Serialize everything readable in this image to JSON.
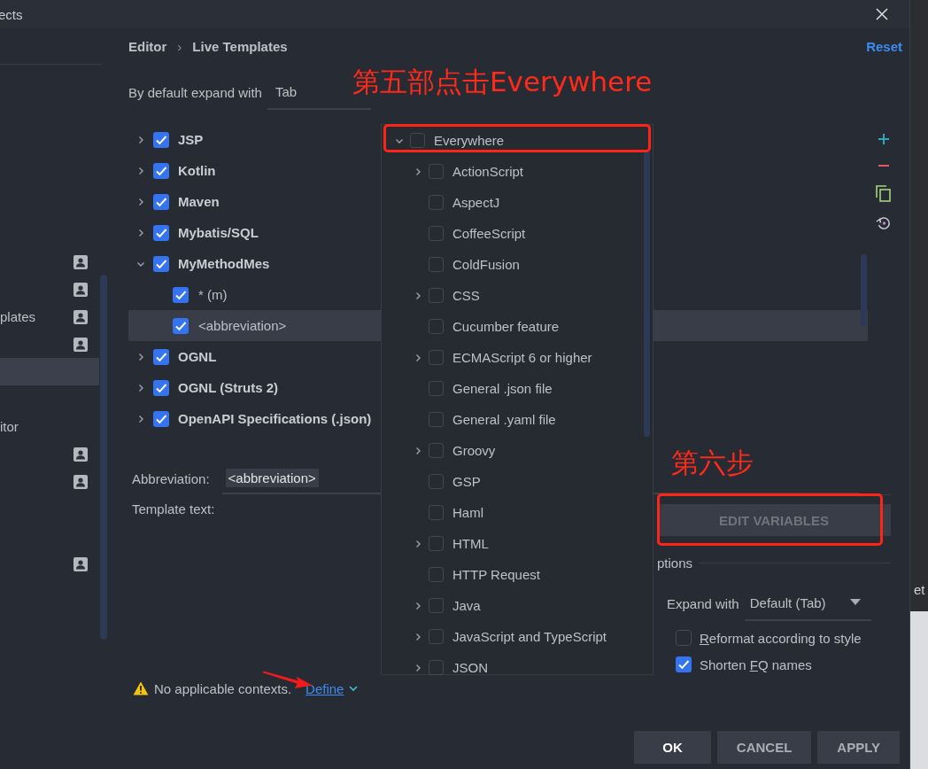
{
  "window": {
    "title": "ects"
  },
  "sidebar": {
    "items": [
      {
        "project_icon": true,
        "selected": false
      },
      {
        "project_icon": true,
        "selected": false
      },
      {
        "label": "plates",
        "project_icon": true,
        "selected": false
      },
      {
        "project_icon": true,
        "selected": false
      },
      {
        "project_icon": false,
        "selected": true
      },
      {
        "project_icon": false,
        "selected": false
      },
      {
        "label": "itor",
        "project_icon": false,
        "selected": false
      },
      {
        "project_icon": true,
        "selected": false
      },
      {
        "project_icon": true,
        "selected": false
      },
      {
        "project_icon": false,
        "selected": false
      },
      {
        "project_icon": false,
        "selected": false
      },
      {
        "project_icon": true,
        "selected": false
      }
    ]
  },
  "breadcrumb": {
    "items": [
      "Editor",
      "Live Templates"
    ],
    "separator": "›"
  },
  "reset_link": "Reset",
  "expand_default": {
    "label": "By default expand with",
    "value": "Tab"
  },
  "template_groups": [
    {
      "label": "JSP",
      "checked": true,
      "expanded": false
    },
    {
      "label": "Kotlin",
      "checked": true,
      "expanded": false
    },
    {
      "label": "Maven",
      "checked": true,
      "expanded": false
    },
    {
      "label": "Mybatis/SQL",
      "checked": true,
      "expanded": false
    },
    {
      "label": "MyMethodMes",
      "checked": true,
      "expanded": true,
      "children": [
        {
          "label": "* (m)",
          "checked": true,
          "selected": false
        },
        {
          "label": "<abbreviation>",
          "checked": true,
          "selected": true
        }
      ]
    },
    {
      "label": "OGNL",
      "checked": true,
      "expanded": false
    },
    {
      "label": "OGNL (Struts 2)",
      "checked": true,
      "expanded": false
    },
    {
      "label": "OpenAPI Specifications (.json)",
      "checked": true,
      "expanded": false
    }
  ],
  "abbreviation": {
    "label": "Abbreviation:",
    "value": "<abbreviation>"
  },
  "template_text": {
    "label": "Template text:"
  },
  "edit_variables_button": {
    "label": "EDIT VARIABLES",
    "disabled": true
  },
  "options": {
    "title": "ptions",
    "expand_with": {
      "label": "Expand with",
      "value": "Default (Tab)"
    },
    "checkboxes": [
      {
        "mnemonic": "R",
        "rest": "eformat according to style",
        "checked": false
      },
      {
        "prefix": "Shorten ",
        "mnemonic": "F",
        "rest": "Q names",
        "checked": true
      }
    ]
  },
  "warning": {
    "text": "No applicable contexts.",
    "link": "Define"
  },
  "buttons": [
    {
      "label": "OK",
      "kind": "default"
    },
    {
      "label": "CANCEL",
      "kind": "normal"
    },
    {
      "label": "APPLY",
      "kind": "normal"
    }
  ],
  "context_popup": {
    "items": [
      {
        "label": "Everywhere",
        "checked": false,
        "expanded": true,
        "children": [
          {
            "label": "ActionScript",
            "checked": false,
            "expandable": true
          },
          {
            "label": "AspectJ",
            "checked": false,
            "expandable": false
          },
          {
            "label": "CoffeeScript",
            "checked": false,
            "expandable": false
          },
          {
            "label": "ColdFusion",
            "checked": false,
            "expandable": false
          },
          {
            "label": "CSS",
            "checked": false,
            "expandable": true
          },
          {
            "label": "Cucumber feature",
            "checked": false,
            "expandable": false
          },
          {
            "label": "ECMAScript 6 or higher",
            "checked": false,
            "expandable": true
          },
          {
            "label": "General .json file",
            "checked": false,
            "expandable": false
          },
          {
            "label": "General .yaml file",
            "checked": false,
            "expandable": false
          },
          {
            "label": "Groovy",
            "checked": false,
            "expandable": true
          },
          {
            "label": "GSP",
            "checked": false,
            "expandable": false
          },
          {
            "label": "Haml",
            "checked": false,
            "expandable": false
          },
          {
            "label": "HTML",
            "checked": false,
            "expandable": true
          },
          {
            "label": "HTTP Request",
            "checked": false,
            "expandable": false
          },
          {
            "label": "Java",
            "checked": false,
            "expandable": true
          },
          {
            "label": "JavaScript and TypeScript",
            "checked": false,
            "expandable": true
          },
          {
            "label": "JSON",
            "checked": false,
            "expandable": true
          }
        ]
      }
    ]
  },
  "annotations": [
    {
      "kind": "label",
      "text": "第五部点击Everywhere"
    },
    {
      "kind": "box"
    },
    {
      "kind": "label",
      "text": "第六步"
    },
    {
      "kind": "box"
    },
    {
      "kind": "arrow"
    }
  ],
  "background_window": {
    "text": "et"
  }
}
